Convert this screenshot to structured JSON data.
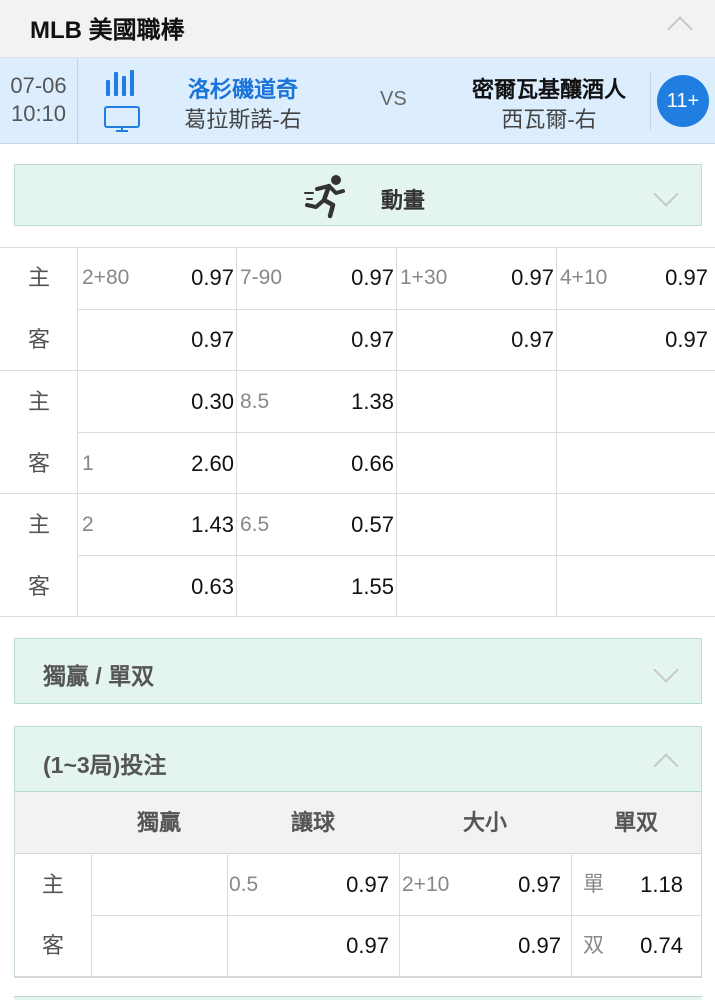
{
  "league": {
    "title": "MLB 美國職棒"
  },
  "match": {
    "date": "07-06",
    "time": "10:10",
    "home_team": "洛杉磯道奇",
    "home_pitcher": "葛拉斯諾-右",
    "vs": "VS",
    "away_team": "密爾瓦基釀酒人",
    "away_pitcher": "西瓦爾-右",
    "more_count": "11+"
  },
  "animation": {
    "label": "動畫"
  },
  "odds": {
    "blocks": [
      {
        "rows": [
          {
            "side": "主",
            "cols": [
              {
                "h": "2+80",
                "o": "0.97"
              },
              {
                "h": "7-90",
                "o": "0.97"
              },
              {
                "h": "1+30",
                "o": "0.97"
              },
              {
                "h": "4+10",
                "o": "0.97"
              }
            ]
          },
          {
            "side": "客",
            "cols": [
              {
                "h": "",
                "o": "0.97"
              },
              {
                "h": "",
                "o": "0.97"
              },
              {
                "h": "",
                "o": "0.97"
              },
              {
                "h": "",
                "o": "0.97"
              }
            ]
          }
        ]
      },
      {
        "rows": [
          {
            "side": "主",
            "cols": [
              {
                "h": "",
                "o": "0.30"
              },
              {
                "h": "8.5",
                "o": "1.38"
              }
            ]
          },
          {
            "side": "客",
            "cols": [
              {
                "h": "1",
                "o": "2.60"
              },
              {
                "h": "",
                "o": "0.66"
              }
            ]
          }
        ]
      },
      {
        "rows": [
          {
            "side": "主",
            "cols": [
              {
                "h": "2",
                "o": "1.43"
              },
              {
                "h": "6.5",
                "o": "0.57"
              }
            ]
          },
          {
            "side": "客",
            "cols": [
              {
                "h": "",
                "o": "0.63"
              },
              {
                "h": "",
                "o": "1.55"
              }
            ]
          }
        ]
      }
    ]
  },
  "sections": {
    "win_oddeven": "獨贏 / 單双",
    "innings_1_3": "(1~3局)投注"
  },
  "innings_table": {
    "headers": [
      "獨贏",
      "讓球",
      "大小",
      "單双"
    ],
    "rows": [
      {
        "side": "主",
        "handicap": "0.5",
        "handicap_odd": "0.97",
        "ou": "2+10",
        "ou_odd": "0.97",
        "oe": "單",
        "oe_odd": "1.18"
      },
      {
        "side": "客",
        "handicap": "",
        "handicap_odd": "0.97",
        "ou": "",
        "ou_odd": "0.97",
        "oe": "双",
        "oe_odd": "0.74"
      }
    ]
  },
  "colors": {
    "accent_blue": "#1f7ee0",
    "section_green": "#e4f4ee",
    "match_bg": "#dceefe"
  }
}
